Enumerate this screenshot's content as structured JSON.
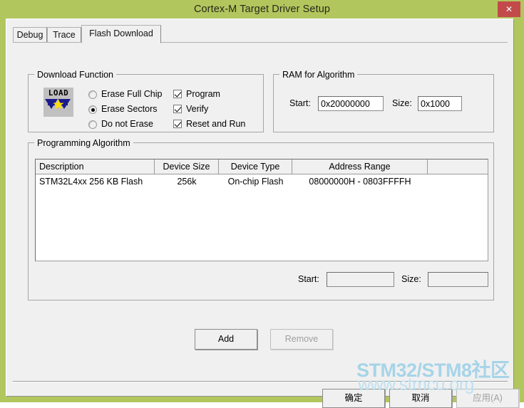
{
  "window": {
    "title": "Cortex-M Target Driver Setup",
    "close_glyph": "✕",
    "titlebar_color": "#b2c65e",
    "close_button_color": "#c34a4a"
  },
  "tabs": [
    {
      "label": "Debug",
      "active": false
    },
    {
      "label": "Trace",
      "active": false
    },
    {
      "label": "Flash Download",
      "active": true
    }
  ],
  "download_function": {
    "title": "Download Function",
    "icon_label": "LOAD",
    "erase_options": [
      {
        "label": "Erase Full Chip",
        "selected": false
      },
      {
        "label": "Erase Sectors",
        "selected": true
      },
      {
        "label": "Do not Erase",
        "selected": false
      }
    ],
    "checkboxes": [
      {
        "label": "Program",
        "checked": true
      },
      {
        "label": "Verify",
        "checked": true
      },
      {
        "label": "Reset and Run",
        "checked": true
      }
    ]
  },
  "ram_for_algorithm": {
    "title": "RAM for Algorithm",
    "start_label": "Start:",
    "start_value": "0x20000000",
    "size_label": "Size:",
    "size_value": "0x1000"
  },
  "programming_algorithm": {
    "title": "Programming Algorithm",
    "columns": [
      "Description",
      "Device Size",
      "Device Type",
      "Address Range",
      ""
    ],
    "rows": [
      {
        "description": "STM32L4xx 256 KB Flash",
        "device_size": "256k",
        "device_type": "On-chip Flash",
        "address_range": "08000000H - 0803FFFFH"
      }
    ],
    "start_label": "Start:",
    "start_value": "",
    "size_label": "Size:",
    "size_value": "",
    "add_label": "Add",
    "remove_label": "Remove",
    "add_enabled": true,
    "remove_enabled": false
  },
  "dialog_buttons": {
    "ok_label": "确定",
    "cancel_label": "取消",
    "apply_label": "应用(A)",
    "apply_enabled": false
  },
  "watermark": {
    "line1": "STM32/STM8社区",
    "line2": "www.stmcu.org",
    "color": "#9fd2e8"
  }
}
